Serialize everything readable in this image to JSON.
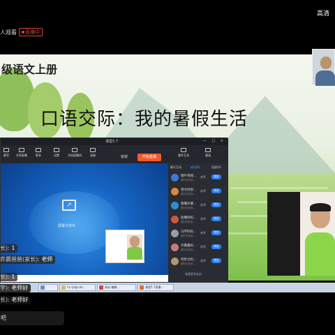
{
  "live": {
    "viewers_text": "人观看",
    "live_badge": "直播中",
    "quality": "高清"
  },
  "slide": {
    "grade_title": "级语文上册",
    "title": "口语交际：我的暑假生活"
  },
  "app": {
    "title": "课堂5.7",
    "window_buttons": "— □ ×",
    "toolbar": [
      {
        "label": "静音",
        "icon": "mute-icon"
      },
      {
        "label": "共享屏幕",
        "icon": "share-screen-icon"
      },
      {
        "label": "更多",
        "icon": "more-icon"
      },
      {
        "label": "设置",
        "icon": "settings-icon"
      },
      {
        "label": "添加直播间",
        "icon": "add-room-icon"
      },
      {
        "label": "录制",
        "icon": "record-icon"
      }
    ],
    "mid_label": "窗镜",
    "start_live": "开始直播",
    "right_tools": [
      {
        "label": "重件互动",
        "icon": "interact-icon"
      },
      {
        "label": "邀请",
        "icon": "invite-icon"
      }
    ],
    "share_label": "屏幕分享中",
    "panel_tabs": [
      "聊天互动",
      "成员(8)",
      "回放(0)"
    ],
    "members": [
      {
        "name": "端午悦铭...",
        "sub": "暂时无状态...",
        "role": "老师",
        "action": "禁言",
        "color": "#3a7bd5"
      },
      {
        "name": "望文妈悦...",
        "sub": "暂时无状态...",
        "role": "老师",
        "action": "禁言",
        "color": "#d9883c"
      },
      {
        "name": "歌曦外婆...",
        "sub": "暂时无状态...",
        "role": "老师",
        "action": "禁言",
        "color": "#2c8fd0"
      },
      {
        "name": "赵曦阿妈...",
        "sub": "暂时无状态...",
        "role": "老师",
        "action": "禁言",
        "color": "#c95a3e"
      },
      {
        "name": "马宇轩妈...",
        "sub": "暂时无状态...",
        "role": "老师",
        "action": "禁言",
        "color": "#9b9bb0"
      },
      {
        "name": "齐鑫鑫妈...",
        "sub": "暂时无状态...",
        "role": "老师",
        "action": "禁言",
        "color": "#c77c7c"
      },
      {
        "name": "何昕文妈...",
        "sub": "暂时无状态...",
        "role": "老师",
        "action": "禁言",
        "color": "#b0986d"
      }
    ],
    "panel_footer": "查看更多成员"
  },
  "chat": [
    {
      "nick": "长):",
      "msg": "1"
    },
    {
      "nick": "弈晨爸爸(家长):",
      "msg": "老师"
    },
    {
      "nick": "长):",
      "msg": "1"
    },
    {
      "nick": "宇):",
      "msg": "老师好"
    },
    {
      "nick": "长):",
      "msg": "老师好"
    }
  ],
  "taskbar": [
    {
      "label": "",
      "color": "#6a8fd0"
    },
    {
      "label": "Cu:\\jdgx.bk...",
      "color": "#e2b93b"
    },
    {
      "label": "网站-编辑...",
      "color": "#d2453b"
    },
    {
      "label": "课堂5.7直播...",
      "color": "#e06a2a"
    }
  ],
  "input_placeholder": "吧"
}
